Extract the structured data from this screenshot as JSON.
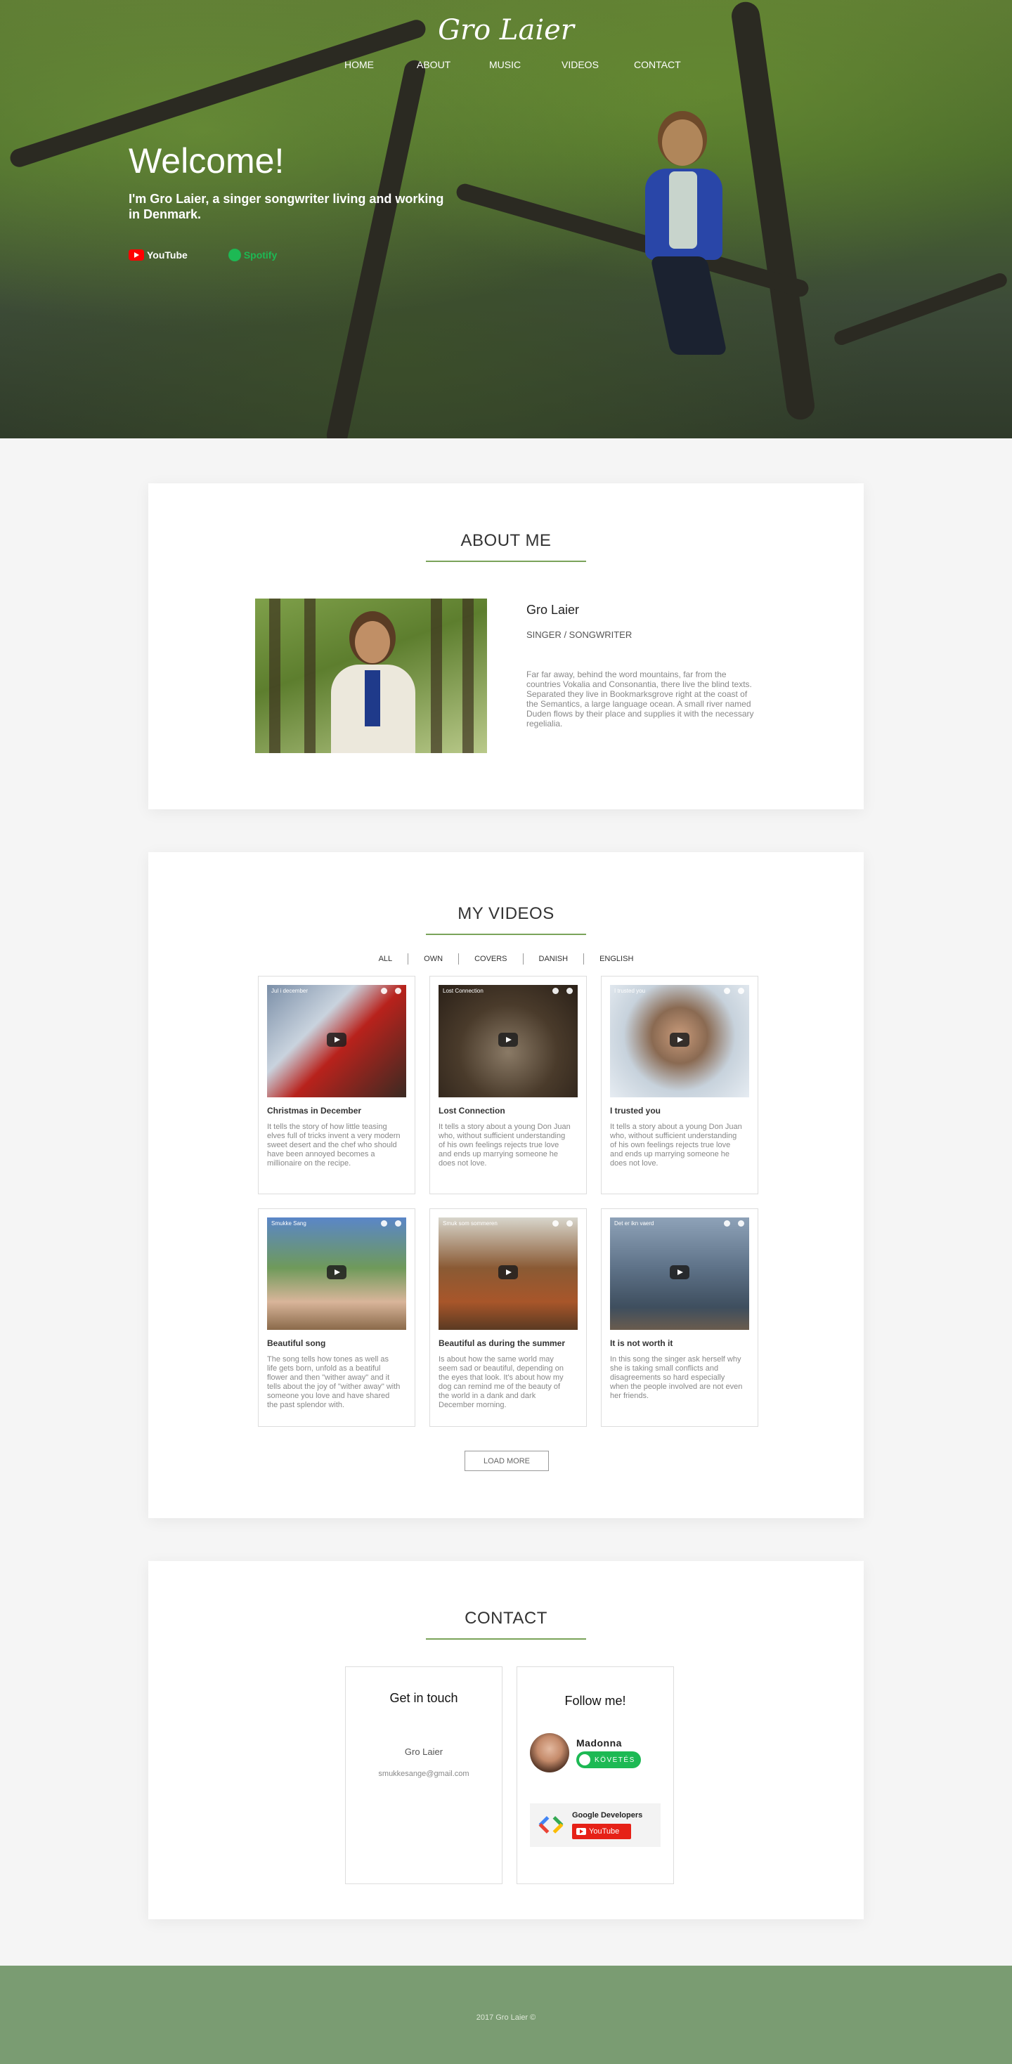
{
  "header": {
    "site_title": "Gro Laier",
    "nav": [
      "HOME",
      "ABOUT",
      "MUSIC",
      "VIDEOS",
      "CONTACT"
    ]
  },
  "hero": {
    "heading": "Welcome!",
    "subheading": "I'm Gro Laier, a singer songwriter living and working in Denmark.",
    "youtube_label": "YouTube",
    "spotify_label": "Spotify"
  },
  "about": {
    "title": "ABOUT ME",
    "name": "Gro Laier",
    "role": "SINGER / SONGWRITER",
    "text": "Far far away, behind the word mountains, far from the countries Vokalia and Consonantia, there live the blind texts. Separated they live in Bookmarksgrove right at the coast of the Semantics, a large language ocean. A small river named Duden flows by their place and supplies it with the necessary regelialia."
  },
  "videos": {
    "title": "MY VIDEOS",
    "filters": [
      "ALL",
      "OWN",
      "COVERS",
      "DANISH",
      "ENGLISH"
    ],
    "items": [
      {
        "thumb_caption": "Jul i december",
        "title": "Christmas in December",
        "desc": "It tells the story of how little teasing elves full of tricks invent a very modern sweet desert and the chef who should have been annoyed becomes a millionaire on the recipe.",
        "theme": "red"
      },
      {
        "thumb_caption": "Lost Connection",
        "title": "Lost Connection",
        "desc": "It tells a story about a young Don Juan who, without sufficient understanding of his own feelings rejects true love and ends up marrying someone he does not love.",
        "theme": "earth"
      },
      {
        "thumb_caption": "I trusted you",
        "title": "I trusted you",
        "desc": "It tells a story about a young Don Juan who, without sufficient understanding of his own feelings rejects true love and ends up marrying someone he does not love.",
        "theme": "portrait"
      },
      {
        "thumb_caption": "Smukke Sang",
        "title": "Beautiful song",
        "desc": "The song tells how tones as well as life gets born, unfold as a beatiful flower and then \"wither away\" and it tells about the joy of \"wither away\" with someone you love and have shared the past splendor with.",
        "theme": "lake"
      },
      {
        "thumb_caption": "Smuk som sommeren",
        "title": "Beautiful as during the summer",
        "desc": "Is about how the same world may seem sad or beautiful, depending on the eyes that look. It's about how my dog can remind me of the beauty of the world in a dank and dark December morning.",
        "theme": "autumn"
      },
      {
        "thumb_caption": "Det er ikn vaerd",
        "title": "It is not worth it",
        "desc": "In this song the singer ask herself why she is taking small conflicts and disagreements so hard especially when the people involved are not even her friends.",
        "theme": "sea"
      }
    ],
    "load_more": "LOAD MORE"
  },
  "contact": {
    "title": "CONTACT",
    "get_in_touch": "Get in touch",
    "person": "Gro Laier",
    "email": "smukkesange@gmail.com",
    "follow_title": "Follow me!",
    "spotify_artist": "Madonna",
    "follow_label": "KÖVETÉS",
    "yt_channel": "Google Developers",
    "yt_button": "YouTube"
  },
  "footer": {
    "text": "2017 Gro Laier ©"
  },
  "colors": {
    "accent": "#7aa35a",
    "footer": "#7a9c72",
    "spotify": "#1db954",
    "youtube": "#e62117"
  }
}
